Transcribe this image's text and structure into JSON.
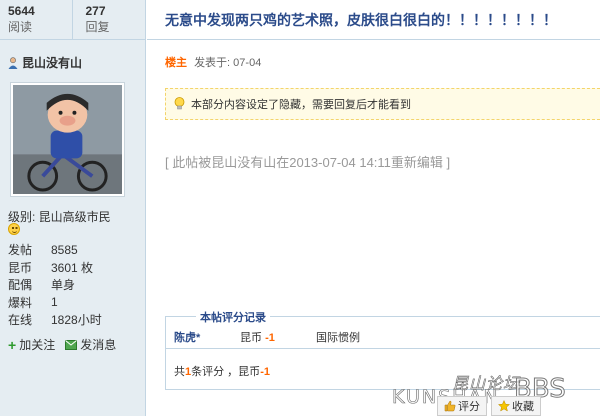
{
  "stats": {
    "views": "5644",
    "views_label": "阅读",
    "replies": "277",
    "replies_label": "回复"
  },
  "author": {
    "name": "昆山没有山"
  },
  "level": "级别: 昆山高级市民",
  "info": [
    {
      "key": "发帖",
      "value": "8585"
    },
    {
      "key": "昆币",
      "value": "3601 枚"
    },
    {
      "key": "配偶",
      "value": "单身"
    },
    {
      "key": "爆料",
      "value": "1"
    },
    {
      "key": "在线",
      "value": "1828小时"
    }
  ],
  "actions": {
    "follow": "加关注",
    "message": "发消息"
  },
  "thread": {
    "title": "无意中发现两只鸡的艺术照，皮肤很白很白的！！！！！！！！"
  },
  "post": {
    "author_tag": "楼主",
    "posted": "发表于: 07-04"
  },
  "notice": "本部分内容设定了隐藏，需要回复后才能看到",
  "edit_note": "[ 此帖被昆山没有山在2013-07-04 14:11重新编辑 ]",
  "rating": {
    "title": "本帖评分记录",
    "user": "陈虎*",
    "coin_label": "昆币",
    "coin_value": "-1",
    "reason": "国际惯例",
    "summary_prefix": "共",
    "summary_count": "1",
    "summary_mid": "条评分 ，昆币",
    "summary_value": "-1"
  },
  "watermark": {
    "cn": "昆山论坛",
    "en": "KUNSHAN",
    "bbs": "BBS"
  },
  "bottom_buttons": {
    "rate": "评分",
    "fav": "收藏"
  }
}
